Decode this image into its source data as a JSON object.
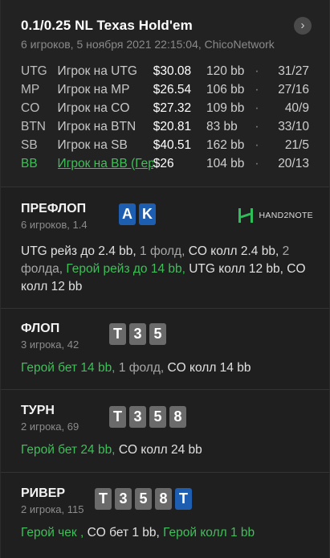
{
  "header": {
    "title": "0.1/0.25 NL Texas Hold'em",
    "subtitle": "6 игроков, 5 ноября 2021 22:15:04, ChicoNetwork",
    "next_icon": "chevron-right-icon"
  },
  "players": [
    {
      "pos": "UTG",
      "name": "Игрок на UTG",
      "stack": "$30.08",
      "bb": "120 bb",
      "sep": "·",
      "stats": "31/27",
      "hero": false
    },
    {
      "pos": "MP",
      "name": "Игрок на MP",
      "stack": "$26.54",
      "bb": "106 bb",
      "sep": "·",
      "stats": "27/16",
      "hero": false
    },
    {
      "pos": "CO",
      "name": "Игрок на CO",
      "stack": "$27.32",
      "bb": "109 bb",
      "sep": "·",
      "stats": "40/9",
      "hero": false
    },
    {
      "pos": "BTN",
      "name": "Игрок на BTN",
      "stack": "$20.81",
      "bb": "83 bb",
      "sep": "·",
      "stats": "33/10",
      "hero": false
    },
    {
      "pos": "SB",
      "name": "Игрок на SB",
      "stack": "$40.51",
      "bb": "162 bb",
      "sep": "·",
      "stats": "21/5",
      "hero": false
    },
    {
      "pos": "BB",
      "name": "Игрок на BB (Герой)",
      "stack": "$26",
      "bb": "104 bb",
      "sep": "·",
      "stats": "20/13",
      "hero": true
    }
  ],
  "preflop": {
    "title": "ПРЕФЛОП",
    "sub": "6 игроков, 1.4",
    "cards": [
      "A",
      "K"
    ],
    "logo_text": "HAND2NOTE",
    "actions": [
      {
        "t": "UTG рейз до 2.4 bb, ",
        "c": "n"
      },
      {
        "t": "1 фолд, ",
        "c": "g"
      },
      {
        "t": "CO колл 2.4 bb, ",
        "c": "n"
      },
      {
        "t": "2 фолда, ",
        "c": "g"
      },
      {
        "t": "Герой рейз до 14 bb, ",
        "c": "h"
      },
      {
        "t": "UTG колл 12 bb, CO колл 12 bb",
        "c": "n"
      }
    ]
  },
  "flop": {
    "title": "ФЛОП",
    "sub": "3 игрока, 42",
    "cards": [
      "T",
      "3",
      "5"
    ],
    "actions": [
      {
        "t": "Герой бет 14 bb, ",
        "c": "h"
      },
      {
        "t": "1 фолд, ",
        "c": "g"
      },
      {
        "t": "CO колл 14 bb",
        "c": "n"
      }
    ]
  },
  "turn": {
    "title": "ТУРН",
    "sub": "2 игрока, 69",
    "cards": [
      "T",
      "3",
      "5",
      "8"
    ],
    "actions": [
      {
        "t": "Герой бет 24 bb, ",
        "c": "h"
      },
      {
        "t": "CO колл 24 bb",
        "c": "n"
      }
    ]
  },
  "river": {
    "title": "РИВЕР",
    "sub": "2 игрока, 115",
    "cards": [
      "T",
      "3",
      "5",
      "8",
      "T"
    ],
    "blue_index": 4,
    "actions": [
      {
        "t": "Герой чек , ",
        "c": "h"
      },
      {
        "t": "CO бет 1 bb, ",
        "c": "n"
      },
      {
        "t": "Герой колл 1 bb",
        "c": "h"
      }
    ]
  }
}
